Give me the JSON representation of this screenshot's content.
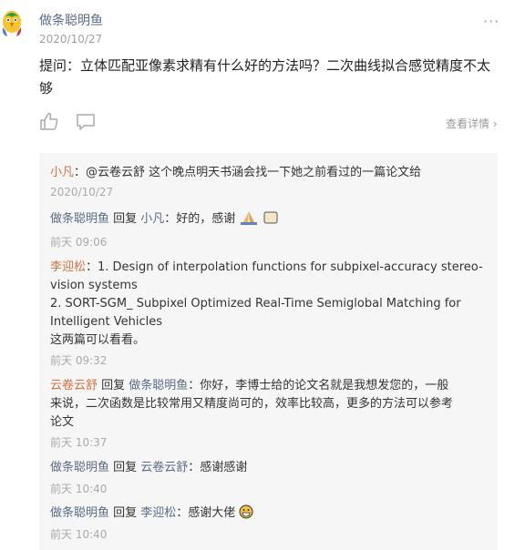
{
  "post": {
    "author": "做条聪明鱼",
    "date": "2020/10/27",
    "question": "提问：立体匹配亚像素求精有什么好的方法吗？二次曲线拟合感觉精度不太够",
    "view_detail": "查看详情",
    "more_icon": "ellipsis-icon"
  },
  "comments": [
    {
      "name": "小凡",
      "text": "：@云卷云舒 这个晚点明天书涵会找一下她之前看过的一篇论文给",
      "time": "2020/10/27"
    },
    {
      "name": "做条聪明鱼",
      "reply_word": " 回复 ",
      "reply_to": "小凡",
      "text": "：好的，感谢",
      "time": "前天 09:06"
    },
    {
      "name": "李迎松",
      "line1": "：1. Design of interpolation functions for subpixel-accuracy stereo-",
      "line2": "vision systems",
      "line3": "2. SORT-SGM_ Subpixel Optimized Real-Time Semiglobal Matching for",
      "line4": "Intelligent Vehicles",
      "line5": "这两篇可以看看。",
      "time": "前天 09:32"
    },
    {
      "name": "云卷云舒",
      "reply_word": " 回复 ",
      "reply_to": "做条聪明鱼",
      "line1": "：你好，李博士给的论文名就是我想发您的，一般",
      "line2": "来说，二次函数是比较常用又精度尚可的，效率比较高，更多的方法可以参考",
      "line3": "论文",
      "time": "前天 10:37"
    },
    {
      "name": "做条聪明鱼",
      "reply_word": " 回复 ",
      "reply_to": "云卷云舒",
      "text": "：感谢感谢",
      "time": "前天 10:40"
    },
    {
      "name": "做条聪明鱼",
      "reply_word": " 回复 ",
      "reply_to": "李迎松",
      "text": "：感谢大佬",
      "time": "前天 10:40"
    }
  ],
  "colors": {
    "name_orange": "#d57143",
    "name_blue": "#5b6b86",
    "panel_bg": "#f6f6f6",
    "muted": "#aaaaaa"
  },
  "icons": [
    "parrot-avatar-icon",
    "thumbs-up-icon",
    "comment-icon",
    "chevron-right-icon",
    "praying-hands-icon",
    "pray-emoji-icon",
    "grinning-emoji-icon"
  ]
}
